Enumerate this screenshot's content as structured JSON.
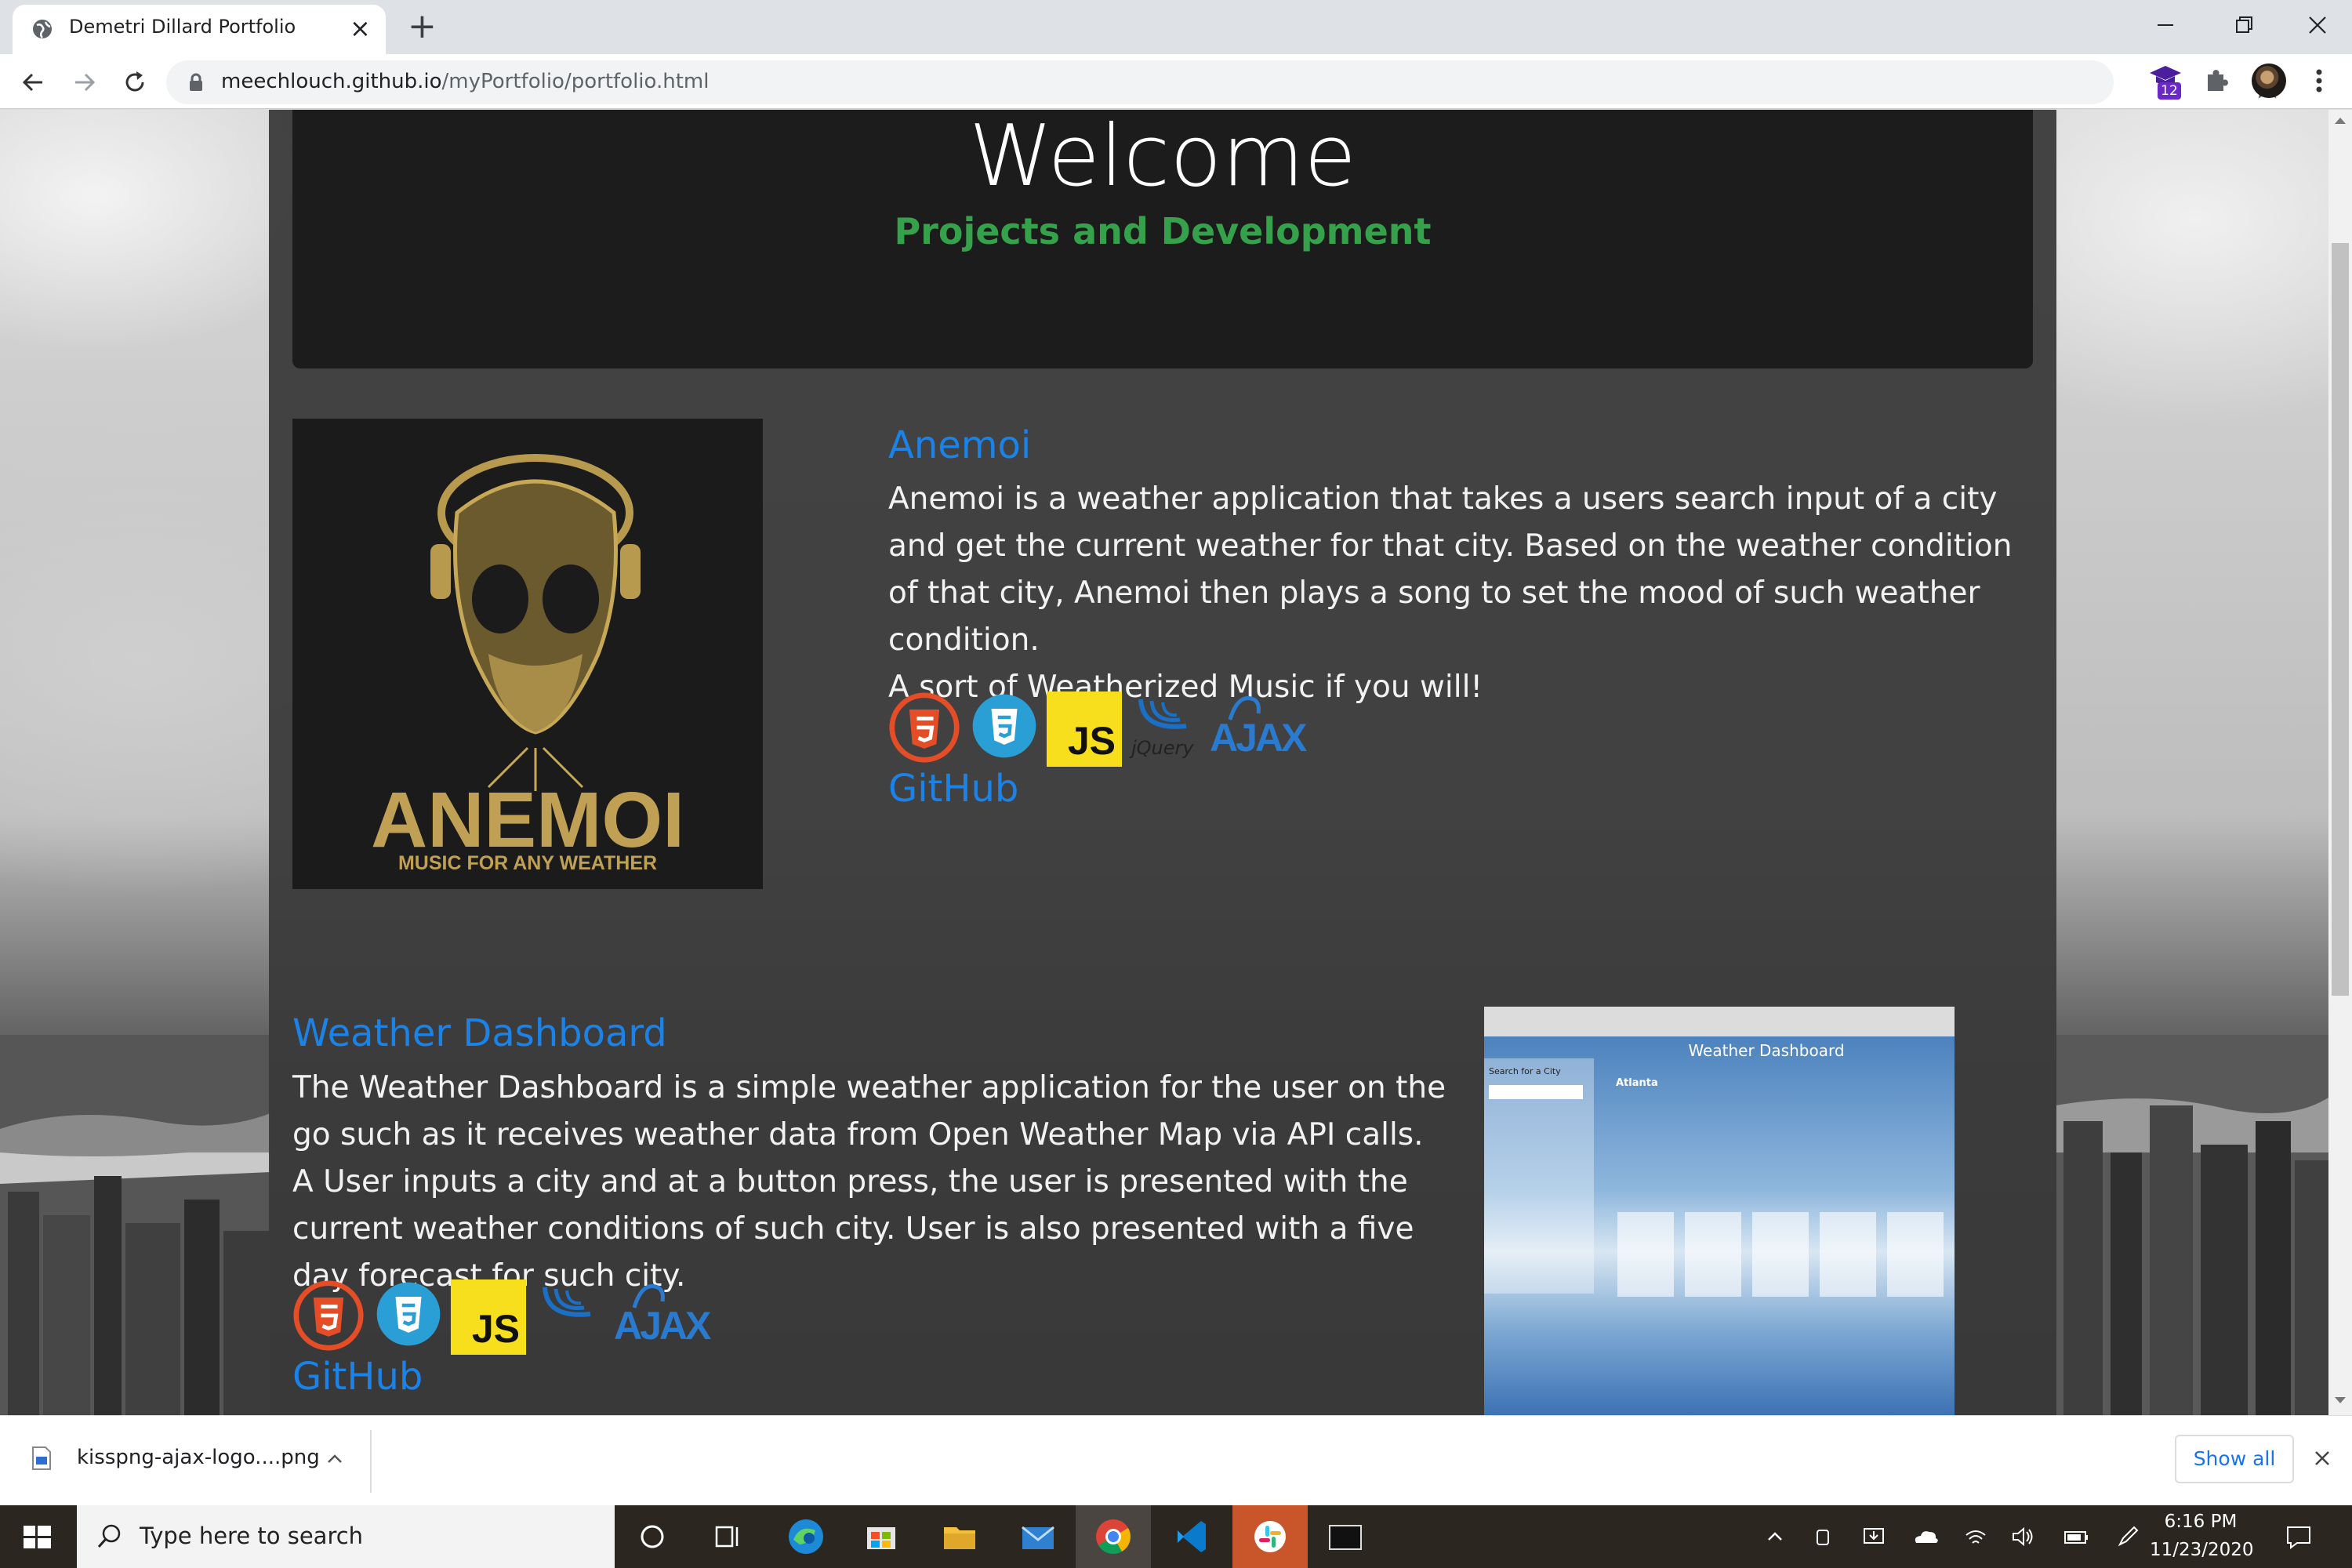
{
  "browser": {
    "tab_title": "Demetri Dillard Portfolio",
    "tab_close": "×",
    "new_tab": "+",
    "url_domain": "meechlouch.github.io",
    "url_path": "/myPortfolio/portfolio.html",
    "extension_badge": "12"
  },
  "page": {
    "welcome_title": "Welcome",
    "welcome_subtitle": "Projects and Development",
    "colors": {
      "title_link": "#1b83e8",
      "subtitle_green": "#35a24b",
      "panel": "#3a3a3a",
      "jumbotron": "#1c1c1c"
    },
    "projects": [
      {
        "title": "Anemoi",
        "description": "Anemoi is a weather application that takes a users search input of a city and get the current weather for that city. Based on the weather condition of that city, Anemoi then plays a song to set the mood of such weather condition.",
        "description_extra": "A sort of Weatherized Music if you will!",
        "image_text": "ANEMOI",
        "image_subtext": "MUSIC FOR ANY WEATHER",
        "tech": [
          "html5-icon",
          "css3-icon",
          "javascript-icon",
          "jquery-icon",
          "ajax-icon"
        ],
        "github_label": "GitHub"
      },
      {
        "title": "Weather Dashboard",
        "description": "The Weather Dashboard is a simple weather application for the user on the go such as it receives weather data from Open Weather Map via API calls. A User inputs a city and at a button press, the user is presented with the current weather conditions of such city. User is also presented with a five day forecast for such city.",
        "screenshot_title": "Weather Dashboard",
        "screenshot_sidebar_label": "Search for a City",
        "screenshot_city": "Atlanta",
        "tech": [
          "html5-icon",
          "css3-icon",
          "javascript-icon",
          "jquery-icon",
          "ajax-icon"
        ],
        "github_label": "GitHub"
      }
    ],
    "tech_labels": {
      "html": "HTML",
      "js": "JS",
      "jquery": "jQuery",
      "ajax": "AJAX"
    }
  },
  "download_bar": {
    "filename": "kisspng-ajax-logo....png",
    "show_all_label": "Show all"
  },
  "taskbar": {
    "search_placeholder": "Type here to search",
    "time": "6:16 PM",
    "date": "11/23/2020",
    "apps": [
      "task-view-icon",
      "cortana-icon",
      "edge-icon",
      "store-icon",
      "file-explorer-icon",
      "mail-icon",
      "chrome-icon",
      "vscode-icon",
      "slack-icon",
      "terminal-icon"
    ]
  }
}
